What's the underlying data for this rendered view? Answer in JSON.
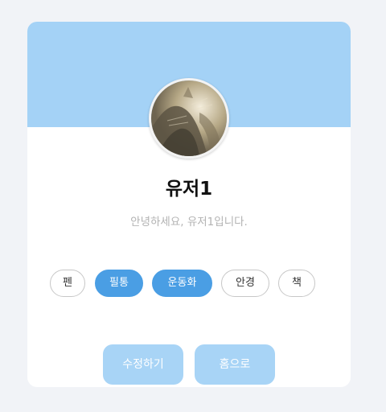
{
  "profile": {
    "name": "유저1",
    "greeting": "안녕하세요, 유저1입니다.",
    "avatar_icon": "cat-photo-avatar"
  },
  "tags": [
    {
      "label": "펜",
      "selected": false
    },
    {
      "label": "필통",
      "selected": true
    },
    {
      "label": "운동화",
      "selected": true
    },
    {
      "label": "안경",
      "selected": false
    },
    {
      "label": "책",
      "selected": false
    }
  ],
  "actions": {
    "edit_label": "수정하기",
    "home_label": "홈으로"
  },
  "colors": {
    "page_background": "#f1f3f7",
    "banner": "#a4d2f6",
    "tag_selected": "#4a9ee4",
    "button": "#a8d4f6"
  }
}
